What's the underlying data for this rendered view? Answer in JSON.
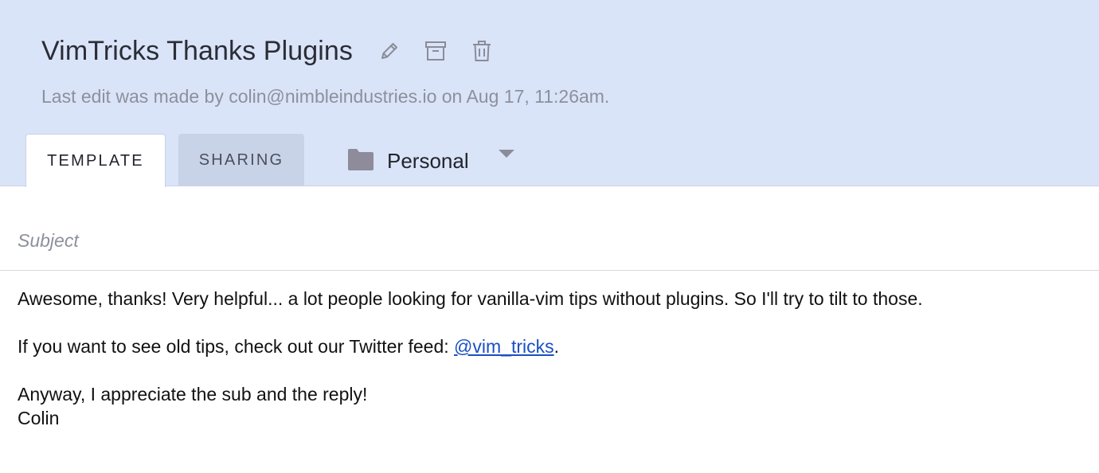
{
  "header": {
    "title": "VimTricks Thanks Plugins",
    "meta_text": "Last edit was made by colin@nimbleindustries.io on Aug 17, 11:26am.",
    "icons": [
      "pencil-icon",
      "archive-icon",
      "trash-icon"
    ]
  },
  "tabs": [
    {
      "label": "TEMPLATE",
      "active": true
    },
    {
      "label": "SHARING",
      "active": false
    }
  ],
  "folder": {
    "icon": "folder-icon",
    "name": "Personal"
  },
  "subject": {
    "placeholder": "Subject",
    "value": ""
  },
  "message": {
    "paragraph1": "Awesome, thanks! Very helpful... a lot people looking for vanilla-vim tips without plugins. So I'll try to tilt to those.",
    "paragraph2_prefix": "If you want to see old tips, check out our Twitter feed: ",
    "paragraph2_link": "@vim_tricks",
    "paragraph2_suffix": ".",
    "paragraph3_line1": "Anyway, I appreciate the sub and the reply!",
    "paragraph3_line2": "Colin"
  },
  "colors": {
    "header_bg": "#d9e4f8",
    "inactive_tab_bg": "#c8d3e8",
    "link": "#1a4fc4",
    "muted_text": "#8d909c",
    "icon_gray": "#8a8d99"
  }
}
